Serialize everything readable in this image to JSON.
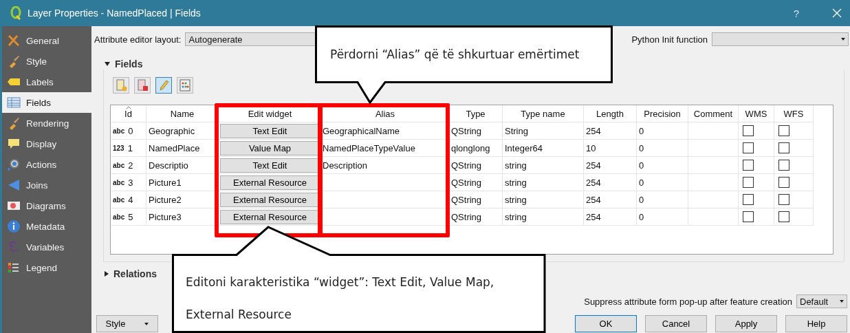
{
  "window": {
    "title": "Layer Properties - NamedPlaced | Fields",
    "help": "?"
  },
  "sidebar": {
    "items": [
      {
        "label": "General",
        "selected": false
      },
      {
        "label": "Style",
        "selected": false
      },
      {
        "label": "Labels",
        "selected": false
      },
      {
        "label": "Fields",
        "selected": true
      },
      {
        "label": "Rendering",
        "selected": false
      },
      {
        "label": "Display",
        "selected": false
      },
      {
        "label": "Actions",
        "selected": false
      },
      {
        "label": "Joins",
        "selected": false
      },
      {
        "label": "Diagrams",
        "selected": false
      },
      {
        "label": "Metadata",
        "selected": false
      },
      {
        "label": "Variables",
        "selected": false
      },
      {
        "label": "Legend",
        "selected": false
      }
    ]
  },
  "editor_layout": {
    "label": "Attribute editor layout:",
    "value": "Autogenerate"
  },
  "python_init": {
    "label": "Python Init function"
  },
  "fields_section": {
    "title": "Fields",
    "expanded": true
  },
  "toolbar": {
    "edit_mode": true
  },
  "table": {
    "columns": [
      {
        "label": "Id",
        "highlighted": false
      },
      {
        "label": "Name",
        "highlighted": false
      },
      {
        "label": "Edit widget",
        "highlighted": true
      },
      {
        "label": "Alias",
        "highlighted": true
      },
      {
        "label": "Type",
        "highlighted": false
      },
      {
        "label": "Type name",
        "highlighted": false
      },
      {
        "label": "Length",
        "highlighted": false
      },
      {
        "label": "Precision",
        "highlighted": false
      },
      {
        "label": "Comment",
        "highlighted": false
      },
      {
        "label": "WMS",
        "highlighted": false
      },
      {
        "label": "WFS",
        "highlighted": false
      }
    ],
    "rows": [
      {
        "type_icon": "abc",
        "id": "0",
        "name": "Geographic",
        "edit_widget": "Text Edit",
        "alias": "GeographicalName",
        "type": "QString",
        "type_name": "String",
        "length": "254",
        "precision": "0",
        "wms": false,
        "wfs": false
      },
      {
        "type_icon": "123",
        "id": "1",
        "name": "NamedPlace",
        "edit_widget": "Value Map",
        "alias": "NamedPlaceTypeValue",
        "type": "qlonglong",
        "type_name": "Integer64",
        "length": "10",
        "precision": "0",
        "wms": false,
        "wfs": false
      },
      {
        "type_icon": "abc",
        "id": "2",
        "name": "Descriptio",
        "edit_widget": "Text Edit",
        "alias": "Description",
        "type": "QString",
        "type_name": "string",
        "length": "254",
        "precision": "0",
        "wms": false,
        "wfs": false
      },
      {
        "type_icon": "abc",
        "id": "3",
        "name": "Picture1",
        "edit_widget": "External Resource",
        "type": "QString",
        "type_name": "string",
        "length": "254",
        "precision": "0",
        "wms": false,
        "wfs": false
      },
      {
        "type_icon": "abc",
        "id": "4",
        "name": "Picture2",
        "edit_widget": "External Resource",
        "type": "QString",
        "type_name": "string",
        "length": "254",
        "precision": "0",
        "wms": false,
        "wfs": false
      },
      {
        "type_icon": "abc",
        "id": "5",
        "name": "Picture3",
        "edit_widget": "External Resource",
        "type": "QString",
        "type_name": "string",
        "length": "254",
        "precision": "0",
        "wms": false,
        "wfs": false
      }
    ]
  },
  "relations_section": {
    "title": "Relations",
    "expanded": false
  },
  "suppress": {
    "label": "Suppress attribute form pop-up after feature creation",
    "value": "Default"
  },
  "buttons": [
    {
      "label": "Style",
      "kind": "menu"
    },
    {
      "label": "OK",
      "kind": "default"
    },
    {
      "label": "Cancel",
      "kind": "normal"
    },
    {
      "label": "Apply",
      "kind": "normal"
    },
    {
      "label": "Help",
      "kind": "normal"
    }
  ],
  "callouts": [
    {
      "lines": [
        "Përdorni “Alias” që të shkurtuar emërtimet"
      ]
    },
    {
      "lines": [
        "Editoni karakteristika “widget”: Text Edit, Value Map,",
        "External Resource"
      ]
    }
  ]
}
